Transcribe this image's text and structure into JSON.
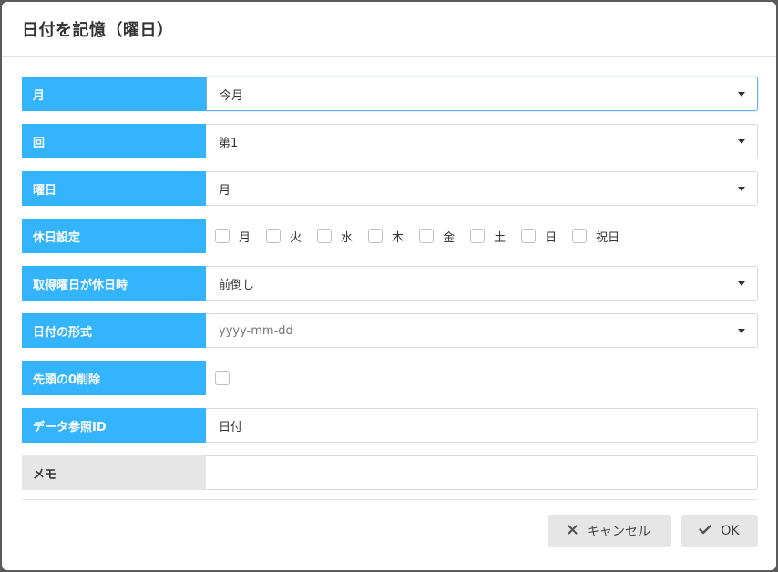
{
  "dialog": {
    "title": "日付を記憶（曜日）"
  },
  "fields": {
    "month": {
      "label": "月",
      "value": "今月"
    },
    "occurrence": {
      "label": "回",
      "value": "第1"
    },
    "weekday": {
      "label": "曜日",
      "value": "月"
    },
    "holiday_settings": {
      "label": "休日設定",
      "options": [
        "月",
        "火",
        "水",
        "木",
        "金",
        "土",
        "日",
        "祝日"
      ]
    },
    "holiday_handling": {
      "label": "取得曜日が休日時",
      "value": "前倒し"
    },
    "date_format": {
      "label": "日付の形式",
      "placeholder": "yyyy-mm-dd"
    },
    "remove_leading_zero": {
      "label": "先頭の0削除"
    },
    "data_ref_id": {
      "label": "データ参照ID",
      "value": "日付"
    },
    "memo": {
      "label": "メモ",
      "value": ""
    }
  },
  "footer": {
    "cancel_label": "キャンセル",
    "ok_label": "OK"
  },
  "colors": {
    "label_bg": "#34b4fc",
    "memo_label_bg": "#e6e6e6",
    "button_bg": "#e6e6e6"
  }
}
